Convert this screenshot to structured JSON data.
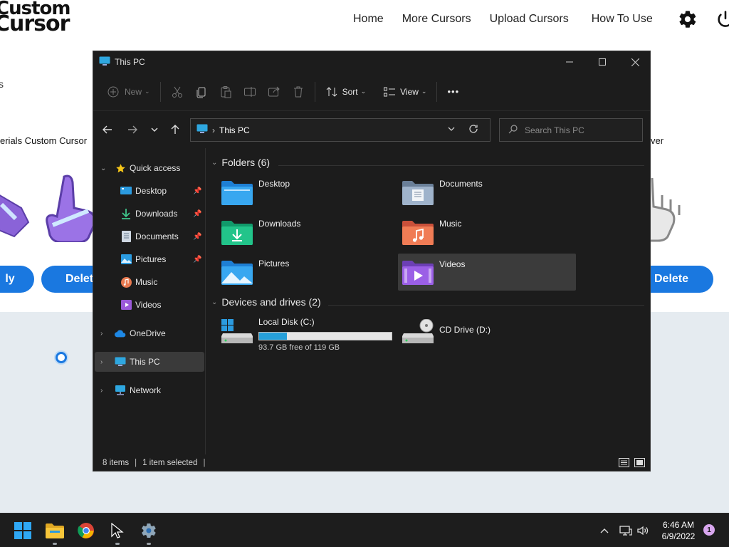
{
  "site": {
    "logo_line1": "ustom",
    "logo_line2": "ursor",
    "nav": [
      "Home",
      "More Cursors",
      "Upload Cursors",
      "How To Use"
    ],
    "card_left_title": "erials Custom Cursor",
    "card_right_title": "ver",
    "btn_left": "ly",
    "btn_left2": "Delet",
    "btn_right": "Delete",
    "stray": "s"
  },
  "window": {
    "title": "This PC",
    "toolbar": {
      "new": "New",
      "sort": "Sort",
      "view": "View",
      "more": "•••"
    },
    "address": {
      "path": "This PC"
    },
    "search": {
      "placeholder": "Search This PC"
    },
    "nav_pane": {
      "quick_access": "Quick access",
      "items": [
        "Desktop",
        "Downloads",
        "Documents",
        "Pictures",
        "Music",
        "Videos"
      ],
      "onedrive": "OneDrive",
      "this_pc": "This PC",
      "network": "Network"
    },
    "folders_header": "Folders (6)",
    "folders": [
      "Desktop",
      "Documents",
      "Downloads",
      "Music",
      "Pictures",
      "Videos"
    ],
    "devices_header": "Devices and drives (2)",
    "drives": {
      "c_name": "Local Disk (C:)",
      "c_free": "93.7 GB free of 119 GB",
      "c_used_fraction": 0.21,
      "d_name": "CD Drive (D:)"
    },
    "status": {
      "items": "8 items",
      "selected": "1 item selected"
    }
  },
  "taskbar": {
    "time": "6:46 AM",
    "date": "6/9/2022",
    "notifications": "1"
  }
}
